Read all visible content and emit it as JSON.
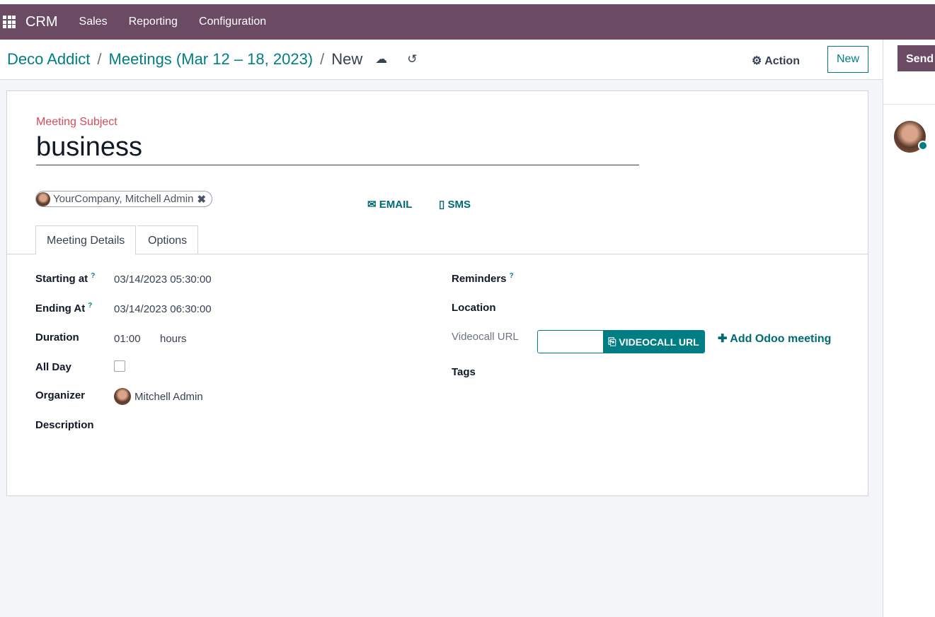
{
  "nav": {
    "app": "CRM",
    "menu": [
      "Sales",
      "Reporting",
      "Configuration"
    ]
  },
  "breadcrumb": {
    "items": [
      "Deco Addict",
      "Meetings (Mar 12 – 18, 2023)"
    ],
    "current": "New"
  },
  "toolbar": {
    "action": "Action",
    "new": "New"
  },
  "chatter": {
    "send": "Send"
  },
  "form": {
    "subject_label": "Meeting Subject",
    "subject": "business",
    "attendee": "YourCompany, Mitchell Admin",
    "email": "EMAIL",
    "sms": "SMS",
    "tabs": [
      "Meeting Details",
      "Options"
    ],
    "start_label": "Starting at",
    "start": "03/14/2023 05:30:00",
    "end_label": "Ending At",
    "end": "03/14/2023 06:30:00",
    "duration_label": "Duration",
    "duration": "01:00",
    "duration_unit": "hours",
    "allday_label": "All Day",
    "allday": false,
    "organizer_label": "Organizer",
    "organizer": "Mitchell Admin",
    "description_label": "Description",
    "reminders_label": "Reminders",
    "location_label": "Location",
    "videocall_label": "Videocall URL",
    "videocall_button": "VIDEOCALL URL",
    "add_meeting": "Add Odoo meeting",
    "tags_label": "Tags",
    "help": "?"
  },
  "colors": {
    "brand": "#6b4a64",
    "accent": "#017e84",
    "subject_label": "#d44c59"
  }
}
